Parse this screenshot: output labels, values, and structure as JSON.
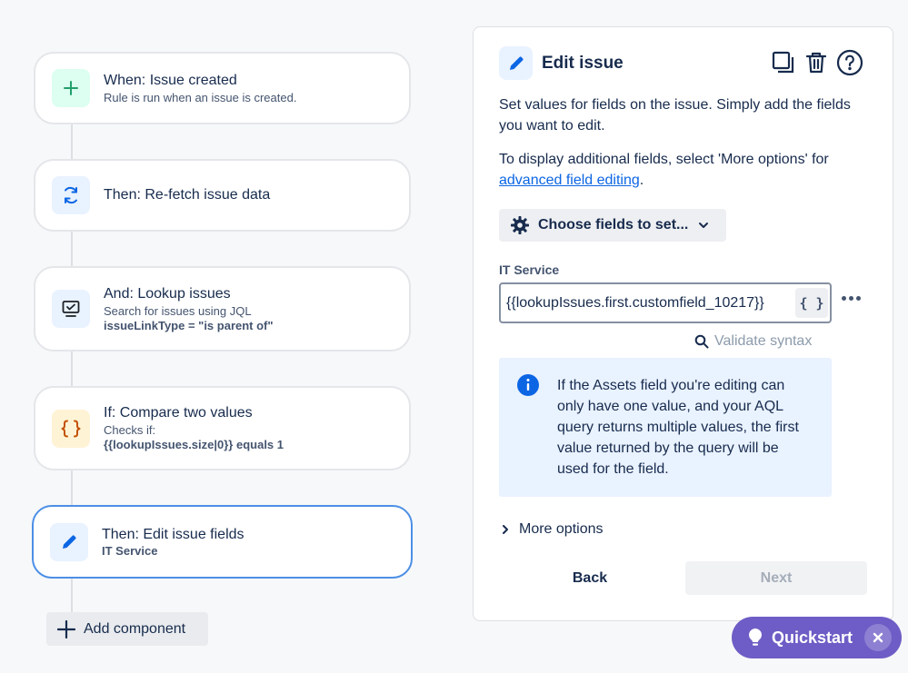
{
  "steps": [
    {
      "title": "When: Issue created",
      "sub": "Rule is run when an issue is created.",
      "icon": "plus-icon"
    },
    {
      "title": "Then: Re-fetch issue data",
      "icon": "refresh-icon"
    },
    {
      "title": "And: Lookup issues",
      "sub": "Search for issues using JQL",
      "bold": "issueLinkType = \"is parent of\"",
      "icon": "monitor-icon"
    },
    {
      "title": "If: Compare two values",
      "sub": "Checks if:",
      "bold": "{{lookupIssues.size|0}} equals 1",
      "icon": "curly-braces-icon"
    },
    {
      "title": "Then: Edit issue fields",
      "bold": "IT Service",
      "icon": "pencil-icon"
    }
  ],
  "add_component_label": "Add component",
  "panel": {
    "title": "Edit issue",
    "desc1": "Set values for fields on the issue. Simply add the fields you want to edit.",
    "desc2_prefix": "To display additional fields, select 'More options' for ",
    "desc2_link": "advanced field editing",
    "desc2_suffix": ".",
    "choose_fields_label": "Choose fields to set...",
    "field_label": "IT Service",
    "field_value": "{{lookupIssues.first.customfield_10217}}",
    "smart_value_button": "{ }",
    "validate_label": "Validate syntax",
    "info_text": "If the Assets field you're editing can only have one value, and your AQL query returns multiple values, the first value returned by the query will be used for the field.",
    "more_options_label": "More options",
    "back_label": "Back",
    "next_label": "Next"
  },
  "quickstart_label": "Quickstart",
  "colors": {
    "accent": "#0c66e4",
    "selected_border": "#4c8fe6",
    "quickstart": "#6e5dc6",
    "green": "#22a06b",
    "orange": "#c25100"
  }
}
